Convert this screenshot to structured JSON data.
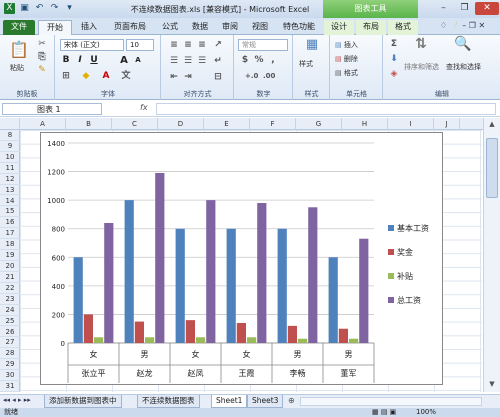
{
  "window": {
    "title": "不连续数据图表.xls  [兼容模式]  -  Microsoft Excel",
    "context_tools": "图表工具"
  },
  "tabs": [
    "文件",
    "开始",
    "插入",
    "页面布局",
    "公式",
    "数据",
    "审阅",
    "视图",
    "特色功能",
    "设计",
    "布局",
    "格式"
  ],
  "ribbon": {
    "clipboard": {
      "paste": "粘贴",
      "label": "剪贴板"
    },
    "font": {
      "name": "宋体 (正文)",
      "size": "10",
      "bold": "B",
      "italic": "I",
      "underline": "U",
      "grow": "A",
      "shrink": "A",
      "label": "字体"
    },
    "alignment": {
      "label": "对齐方式"
    },
    "number": {
      "format": "常规",
      "percent": "%",
      "comma": ",",
      "label": "数字"
    },
    "styles": {
      "label": "样式",
      "name": "样式"
    },
    "cells": {
      "insert": "插入",
      "delete": "删除",
      "format": "格式",
      "label": "单元格"
    },
    "editing": {
      "sigma": "Σ",
      "sort": "排序和筛选",
      "find": "查找和选择",
      "label": "编辑"
    }
  },
  "formula_bar": {
    "name_box": "图表 1",
    "fx": "fx",
    "value": ""
  },
  "columns": [
    "A",
    "B",
    "C",
    "D",
    "E",
    "F",
    "G",
    "H",
    "I",
    "J"
  ],
  "rows": [
    "8",
    "9",
    "10",
    "11",
    "12",
    "13",
    "14",
    "15",
    "16",
    "17",
    "18",
    "19",
    "20",
    "21",
    "22",
    "23",
    "24",
    "25",
    "26",
    "27",
    "28",
    "29",
    "30",
    "31"
  ],
  "sheets": {
    "tab1": "添加新数据到图表中",
    "tab2": "不连续数据图表",
    "tab3": "Sheet1",
    "tab4": "Sheet3"
  },
  "status": {
    "left": "就绪",
    "zoom": "100%"
  },
  "colors": {
    "series1": "#4f81bd",
    "series2": "#c0504d",
    "series3": "#9bbb59",
    "series4": "#8064a2"
  },
  "chart_data": {
    "type": "bar",
    "categories": [
      "张立平",
      "赵龙",
      "赵凤",
      "王霞",
      "李畅",
      "董军"
    ],
    "subcategories": [
      "女",
      "男",
      "女",
      "女",
      "男",
      "男"
    ],
    "series": [
      {
        "name": "基本工资",
        "values": [
          600,
          1000,
          800,
          800,
          800,
          600
        ]
      },
      {
        "name": "奖金",
        "values": [
          200,
          150,
          160,
          140,
          120,
          100
        ]
      },
      {
        "name": "补贴",
        "values": [
          40,
          40,
          40,
          40,
          30,
          30
        ]
      },
      {
        "name": "总工资",
        "values": [
          840,
          1190,
          1000,
          980,
          950,
          730
        ]
      }
    ],
    "ylim": [
      0,
      1400
    ],
    "yticks": [
      0,
      200,
      400,
      600,
      800,
      1000,
      1200,
      1400
    ],
    "legend": "right",
    "grid": true
  }
}
